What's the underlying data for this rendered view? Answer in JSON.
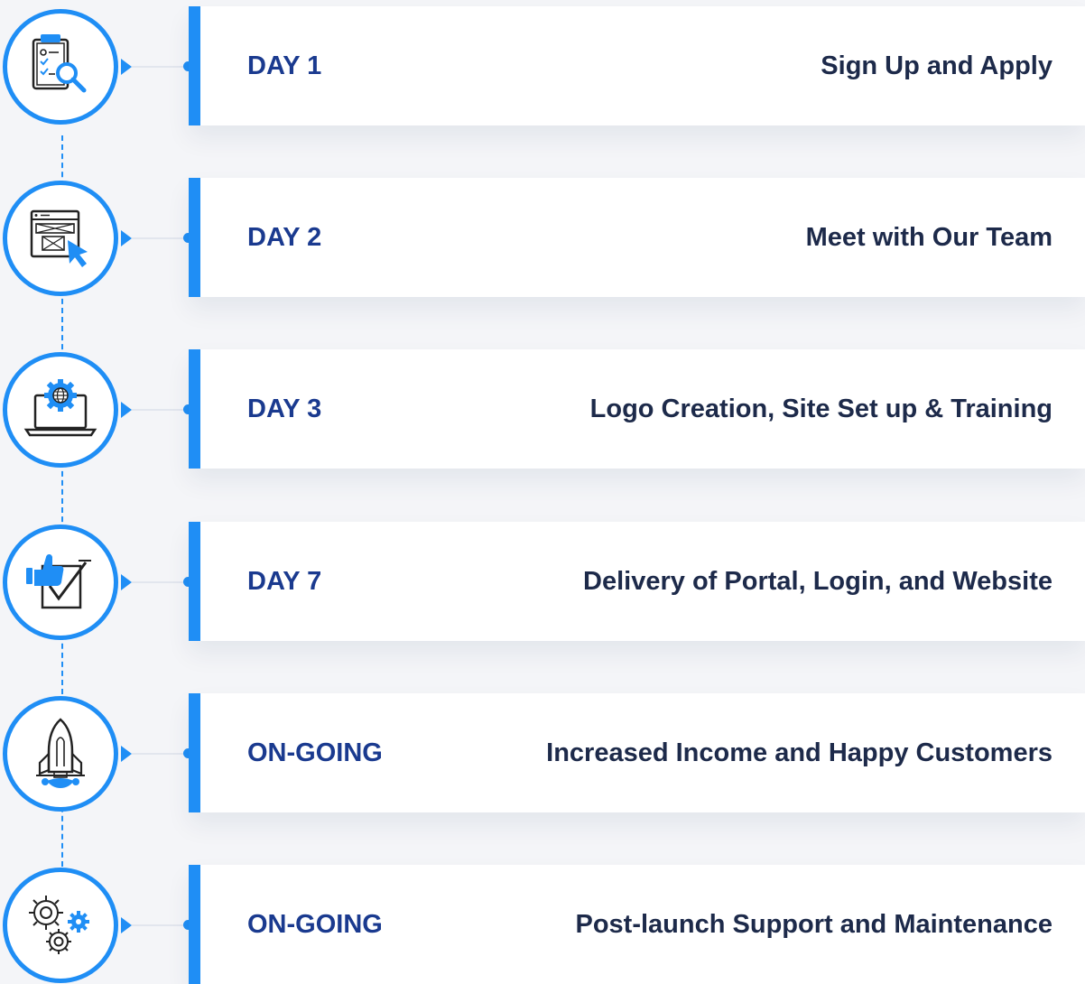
{
  "colors": {
    "accent": "#1f8ef5",
    "day_text": "#1a3a8f",
    "title_text": "#1d2a4a",
    "background": "#f4f5f8"
  },
  "steps": [
    {
      "day": "DAY 1",
      "title": "Sign Up and Apply",
      "icon": "checklist-search-icon"
    },
    {
      "day": "DAY 2",
      "title": "Meet with Our Team",
      "icon": "web-wireframe-cursor-icon"
    },
    {
      "day": "DAY 3",
      "title": "Logo Creation, Site Set up & Training",
      "icon": "laptop-gear-globe-icon"
    },
    {
      "day": "DAY 7",
      "title": "Delivery of Portal, Login, and Website",
      "icon": "thumbs-up-check-icon"
    },
    {
      "day": "ON-GOING",
      "title": "Increased Income and Happy Customers",
      "icon": "rocket-icon"
    },
    {
      "day": "ON-GOING",
      "title": "Post-launch Support and Maintenance",
      "icon": "gears-icon"
    }
  ]
}
